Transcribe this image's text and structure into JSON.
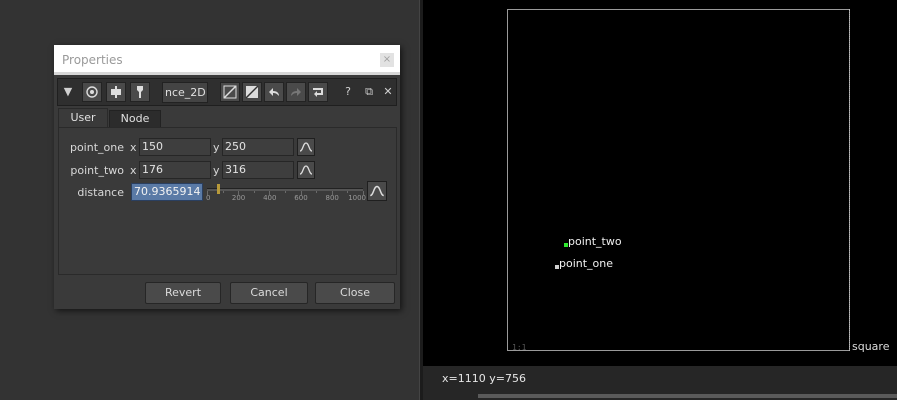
{
  "properties": {
    "title": "Properties",
    "close_glyph": "×",
    "node_name": "nce_2D",
    "toolbar": {
      "collapse_glyph": "▼",
      "help_glyph": "?",
      "float_glyph": "⧉",
      "close_glyph": "✕"
    },
    "tabs": [
      "User",
      "Node"
    ],
    "knobs": {
      "point_one": {
        "label": "point_one",
        "x_label": "x",
        "x": "150",
        "y_label": "y",
        "y": "250"
      },
      "point_two": {
        "label": "point_two",
        "x_label": "x",
        "x": "176",
        "y_label": "y",
        "y": "316"
      },
      "distance": {
        "label": "distance",
        "value": "70.9365914",
        "slider_min": 0,
        "slider_max": 1000,
        "slider_value": 70.9365914,
        "ticks": [
          "0",
          "200",
          "400",
          "600",
          "800",
          "1000"
        ]
      }
    },
    "buttons": {
      "revert": "Revert",
      "cancel": "Cancel",
      "close": "Close"
    }
  },
  "viewer": {
    "format_label": "square",
    "corner_label": "1:1",
    "point_two_label": "point_two",
    "point_one_label": "point_one",
    "point_two_color": "#2ee82e",
    "point_one_color": "#cfcfcf",
    "coord_readout": "x=1110 y=756"
  },
  "icons": {
    "toolbar": [
      "collapse-icon",
      "viewer-icon",
      "node-icon",
      "wrench-icon",
      "input-icon",
      "output-icon",
      "undo-icon",
      "redo-icon",
      "revert-icon",
      "help-icon",
      "float-icon",
      "close-icon"
    ],
    "curve": "curve-icon"
  }
}
